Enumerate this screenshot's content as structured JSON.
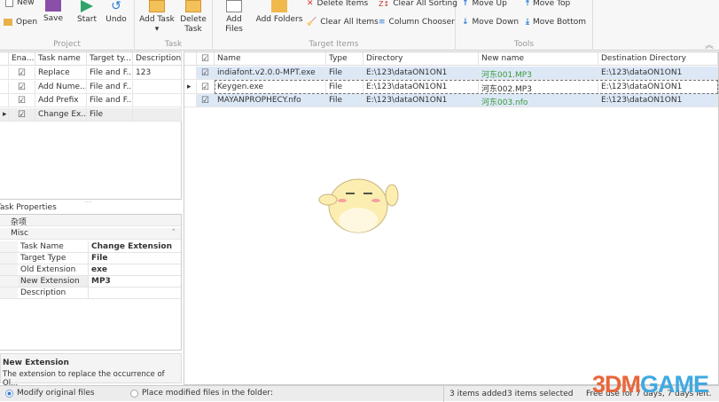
{
  "ribbon": {
    "project": {
      "label": "Project",
      "new": "New",
      "open": "Open",
      "save": "Save",
      "start": "Start",
      "undo": "Undo"
    },
    "task": {
      "label": "Task",
      "add_task": "Add Task",
      "delete_task": "Delete Task"
    },
    "target_items": {
      "label": "Target Items",
      "add_files": "Add Files",
      "add_folders": "Add Folders",
      "delete_items": "Delete Items",
      "clear_all_items": "Clear All Items",
      "clear_all_sorting": "Clear All Sorting",
      "column_chooser": "Column Chooser"
    },
    "tools": {
      "label": "Tools",
      "move_up": "Move Up",
      "move_down": "Move Down",
      "move_top": "Move Top",
      "move_bottom": "Move Bottom"
    }
  },
  "tasks": {
    "columns": [
      "Ena...",
      "Task name",
      "Target ty...",
      "Description"
    ],
    "rows": [
      {
        "enabled": true,
        "name": "Replace",
        "target": "File and F...",
        "description": "123"
      },
      {
        "enabled": true,
        "name": "Add Nume...",
        "target": "File and F...",
        "description": ""
      },
      {
        "enabled": true,
        "name": "Add Prefix",
        "target": "File and F...",
        "description": ""
      },
      {
        "enabled": true,
        "name": "Change Ex...",
        "target": "File",
        "description": ""
      }
    ]
  },
  "task_properties": {
    "title": "Task Properties",
    "category": "杂项",
    "group": "Misc",
    "rows": [
      {
        "key": "Task Name",
        "value": "Change Extension"
      },
      {
        "key": "Target Type",
        "value": "File"
      },
      {
        "key": "Old Extension",
        "value": "exe"
      },
      {
        "key": "New Extension",
        "value": "MP3"
      },
      {
        "key": "Description",
        "value": ""
      }
    ],
    "help_title": "New Extension",
    "help_text": "The extension to replace the occurrence of Ol..."
  },
  "items": {
    "columns": [
      "Name",
      "Type",
      "Directory",
      "New name",
      "Destination Directory"
    ],
    "rows": [
      {
        "checked": true,
        "name": "indiafont.v2.0.0-MPT.exe",
        "type": "File",
        "directory": "E:\\123\\dataON1ON1",
        "new_name": "河东001.MP3",
        "dest": "E:\\123\\dataON1ON1"
      },
      {
        "checked": true,
        "name": "Keygen.exe",
        "type": "File",
        "directory": "E:\\123\\dataON1ON1",
        "new_name": "河东002.MP3",
        "dest": "E:\\123\\dataON1ON1"
      },
      {
        "checked": true,
        "name": "MAYANPROPHECY.nfo",
        "type": "File",
        "directory": "E:\\123\\dataON1ON1",
        "new_name": "河东003.nfo",
        "dest": "E:\\123\\dataON1ON1"
      }
    ]
  },
  "status": {
    "modify_original": "Modify original files",
    "place_modified": "Place modified files in the folder:",
    "items_added": "3 items added",
    "items_selected": "3 items selected",
    "license": "Free use for 7 days, 7 days left."
  },
  "watermark": "3DMGAME",
  "colors": {
    "selected_row": "#dde8f7",
    "green_text": "#3a9a3a",
    "accent": "#2a7bd4"
  }
}
